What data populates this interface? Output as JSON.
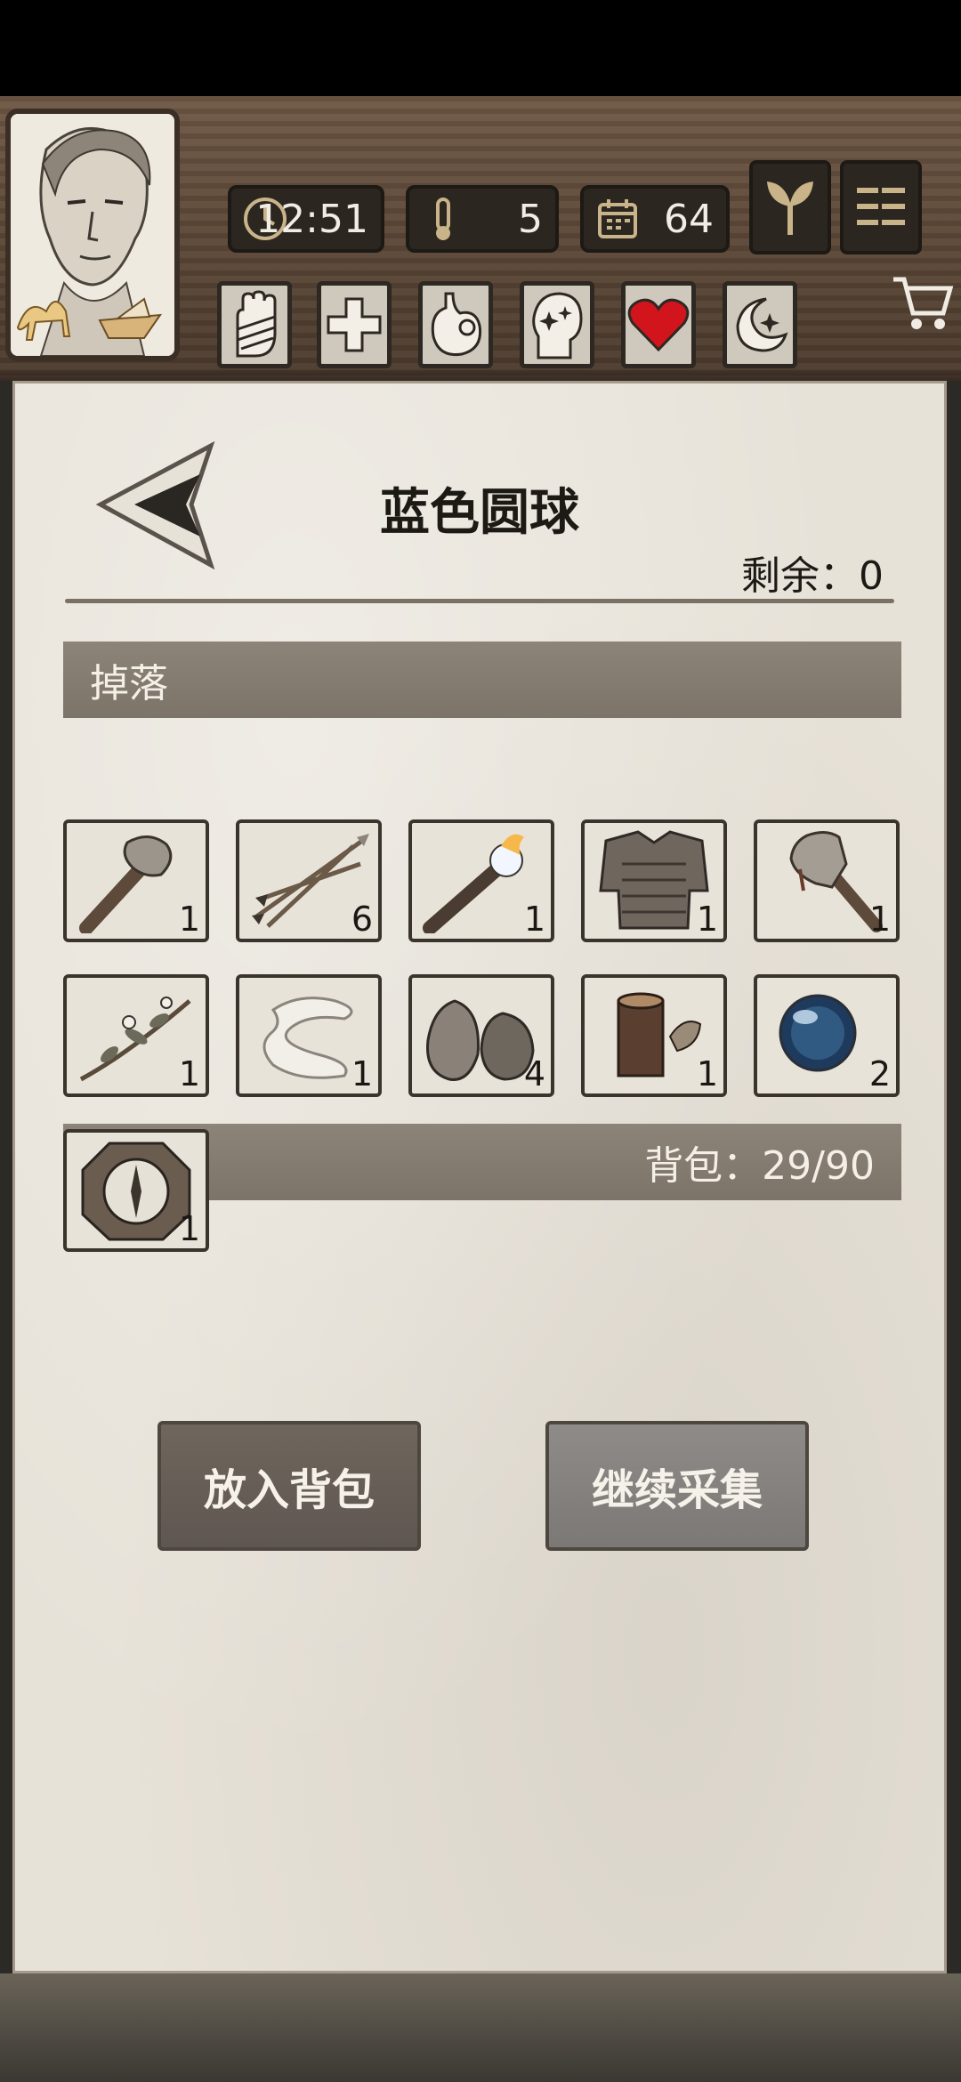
{
  "hud": {
    "time": "12:51",
    "temperature": "5",
    "day": "64"
  },
  "panel": {
    "title": "蓝色圆球",
    "remaining_label": "剩余：0",
    "drop_label": "掉落",
    "bag_label": "背包",
    "bag_capacity": "背包：29/90"
  },
  "inventory": [
    {
      "icon": "stone-axe-icon",
      "count": "1"
    },
    {
      "icon": "arrows-icon",
      "count": "6"
    },
    {
      "icon": "torch-icon",
      "count": "1"
    },
    {
      "icon": "armor-vest-icon",
      "count": "1"
    },
    {
      "icon": "hatchet-icon",
      "count": "1"
    },
    {
      "icon": "herb-branch-icon",
      "count": "1"
    },
    {
      "icon": "bandage-icon",
      "count": "1"
    },
    {
      "icon": "coconut-icon",
      "count": "4"
    },
    {
      "icon": "wood-log-icon",
      "count": "1"
    },
    {
      "icon": "blue-orb-icon",
      "count": "2"
    },
    {
      "icon": "compass-icon",
      "count": "1"
    }
  ],
  "buttons": {
    "put_in_bag": "放入背包",
    "continue_gather": "继续采集"
  }
}
